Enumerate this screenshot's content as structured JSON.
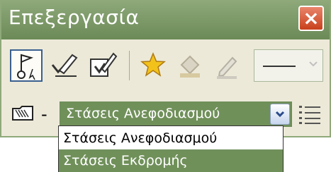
{
  "window": {
    "title": "Επεξεργασία",
    "close_label": "×"
  },
  "toolbar": {
    "tools": [
      {
        "name": "flag-pin-icon",
        "active": true
      },
      {
        "name": "pen-check-icon",
        "active": false
      },
      {
        "name": "checked-box-icon",
        "active": false
      },
      {
        "name": "star-icon",
        "active": false
      },
      {
        "name": "paint-bucket-icon",
        "active": false
      },
      {
        "name": "pencil-icon",
        "active": false
      }
    ],
    "line_style_dropdown": "chevron-down-icon"
  },
  "layer_row": {
    "folder_icon": "folder-icon",
    "prefix": "-",
    "selected_layer": "Στάσεις Ανεφοδιασμού",
    "list_icon": "list-icon"
  },
  "dropdown": {
    "options": [
      "Στάσεις Ανεφοδιασμού",
      "Στάσεις Εκδρομής"
    ],
    "highlighted_index": 1
  },
  "colors": {
    "accent": "#70905a",
    "title_bar": "#7a9866",
    "close_red": "#d2542f",
    "panel_bg": "#ece9d8"
  }
}
